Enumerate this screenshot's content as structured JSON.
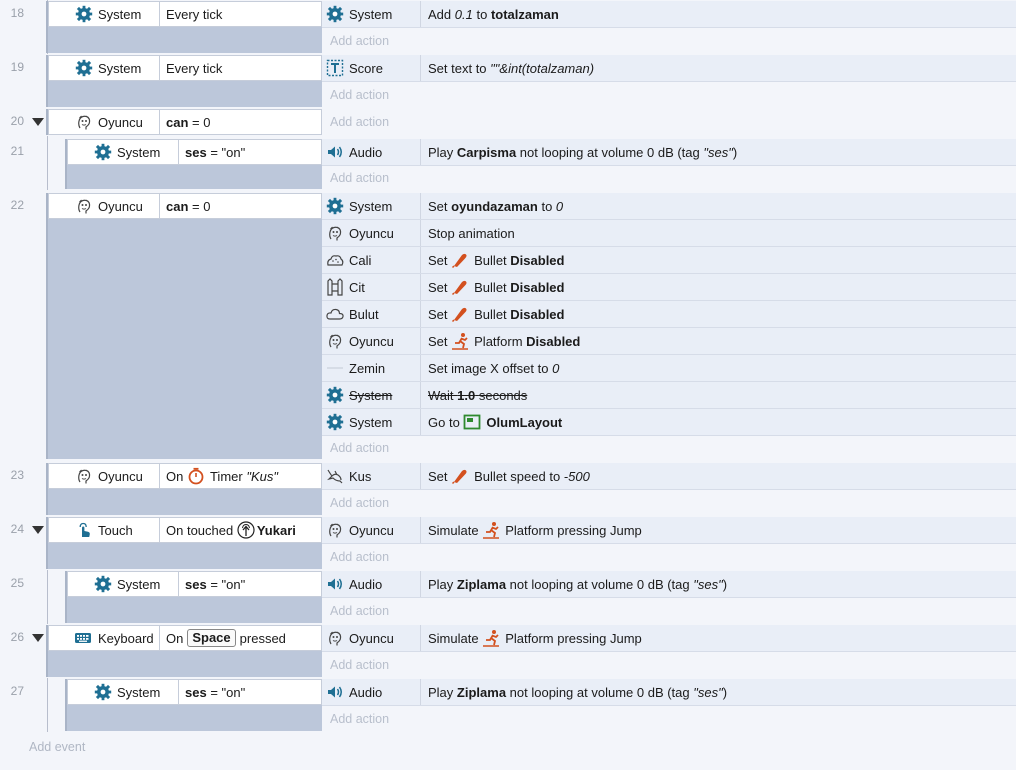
{
  "add_action_label": "Add action",
  "add_event_label": "Add event",
  "events": [
    {
      "num": "18",
      "obj": "System",
      "cond_html": "Every tick",
      "actions": [
        {
          "obj": "System",
          "icon": "gear",
          "text": "Add 0.1 to totalzaman"
        }
      ]
    },
    {
      "num": "19",
      "obj": "System",
      "cond_html": "Every tick",
      "actions": [
        {
          "obj": "Score",
          "icon": "text",
          "text": "Set text to \"\"&int(totalzaman)"
        }
      ]
    },
    {
      "num": "20",
      "obj": "Oyuncu",
      "cond": "can = 0"
    },
    {
      "num": "21",
      "obj": "System",
      "cond": "ses = \"on\"",
      "actions": [
        {
          "obj": "Audio",
          "icon": "speaker",
          "text": "Play Carpisma not looping at volume 0 dB (tag \"ses\")"
        }
      ]
    },
    {
      "num": "22",
      "obj": "Oyuncu",
      "cond": "can = 0",
      "actions": [
        {
          "obj": "System",
          "icon": "gear",
          "text": "Set oyundazaman to 0"
        },
        {
          "obj": "Oyuncu",
          "icon": "face",
          "text": "Stop animation"
        },
        {
          "obj": "Cali",
          "icon": "bush",
          "text": "Set Bullet Disabled"
        },
        {
          "obj": "Cit",
          "icon": "fence",
          "text": "Set Bullet Disabled"
        },
        {
          "obj": "Bulut",
          "icon": "cloud",
          "text": "Set Bullet Disabled"
        },
        {
          "obj": "Oyuncu",
          "icon": "face",
          "text": "Set Platform Disabled"
        },
        {
          "obj": "Zemin",
          "icon": "line",
          "text": "Set image X offset to 0"
        },
        {
          "obj": "System",
          "icon": "gear",
          "text": "Wait 1.0 seconds"
        },
        {
          "obj": "System",
          "icon": "gear",
          "text": "Go to OlumLayout"
        }
      ]
    },
    {
      "num": "23",
      "obj": "Oyuncu",
      "cond": "On Timer \"Kus\"",
      "actions": [
        {
          "obj": "Kus",
          "icon": "bird",
          "text": "Set Bullet speed to -500"
        }
      ]
    },
    {
      "num": "24",
      "obj": "Touch",
      "cond": "On touched Yukari",
      "actions": [
        {
          "obj": "Oyuncu",
          "icon": "face",
          "text": "Simulate Platform pressing Jump"
        }
      ]
    },
    {
      "num": "25",
      "obj": "System",
      "cond": "ses = \"on\"",
      "actions": [
        {
          "obj": "Audio",
          "icon": "speaker",
          "text": "Play Ziplama not looping at volume 0 dB (tag \"ses\")"
        }
      ]
    },
    {
      "num": "26",
      "obj": "Keyboard",
      "cond": "On Space pressed",
      "actions": [
        {
          "obj": "Oyuncu",
          "icon": "face",
          "text": "Simulate Platform pressing Jump"
        }
      ]
    },
    {
      "num": "27",
      "obj": "System",
      "cond": "ses = \"on\"",
      "actions": [
        {
          "obj": "Audio",
          "icon": "speaker",
          "text": "Play Ziplama not looping at volume 0 dB (tag \"ses\")"
        }
      ]
    }
  ],
  "literals": {
    "add": "Add",
    "to": "to",
    "set_text_to": "Set text to",
    "play": "Play",
    "not_looping": "not looping at volume 0 dB (tag",
    "set": "Set",
    "stop_animation": "Stop animation",
    "bullet": "Bullet",
    "disabled": "Disabled",
    "platform": "Platform",
    "set_image_x": "Set image X offset to",
    "wait": "Wait",
    "seconds": "seconds",
    "go_to": "Go to",
    "speed_to": "speed to",
    "simulate": "Simulate",
    "pressing_jump": "pressing Jump",
    "every_tick": "Every tick",
    "on": "On",
    "timer": "Timer",
    "on_touched": "On touched",
    "pressed": "pressed",
    "can": "can",
    "eq0": "= 0",
    "ses": "ses",
    "eq_on": "= \"on\"",
    "close_tag": ")"
  },
  "values": {
    "v01": "0.1",
    "totalzaman": "totalzaman",
    "expr": "\"\"&int(totalzaman)",
    "carpisma": "Carpisma",
    "ziplama": "Ziplama",
    "ses_tag": "\"ses\"",
    "oyundazaman": "oyundazaman",
    "zero": "0",
    "wait_val": "1.0",
    "olumlayout": "OlumLayout",
    "neg500": "-500",
    "kus_tag": "\"Kus\"",
    "yukari": "Yukari",
    "space": "Space"
  },
  "colors": {
    "accent": "#1f6f93",
    "trigger": "#2f8a2f",
    "behavior": "#d3501f"
  }
}
